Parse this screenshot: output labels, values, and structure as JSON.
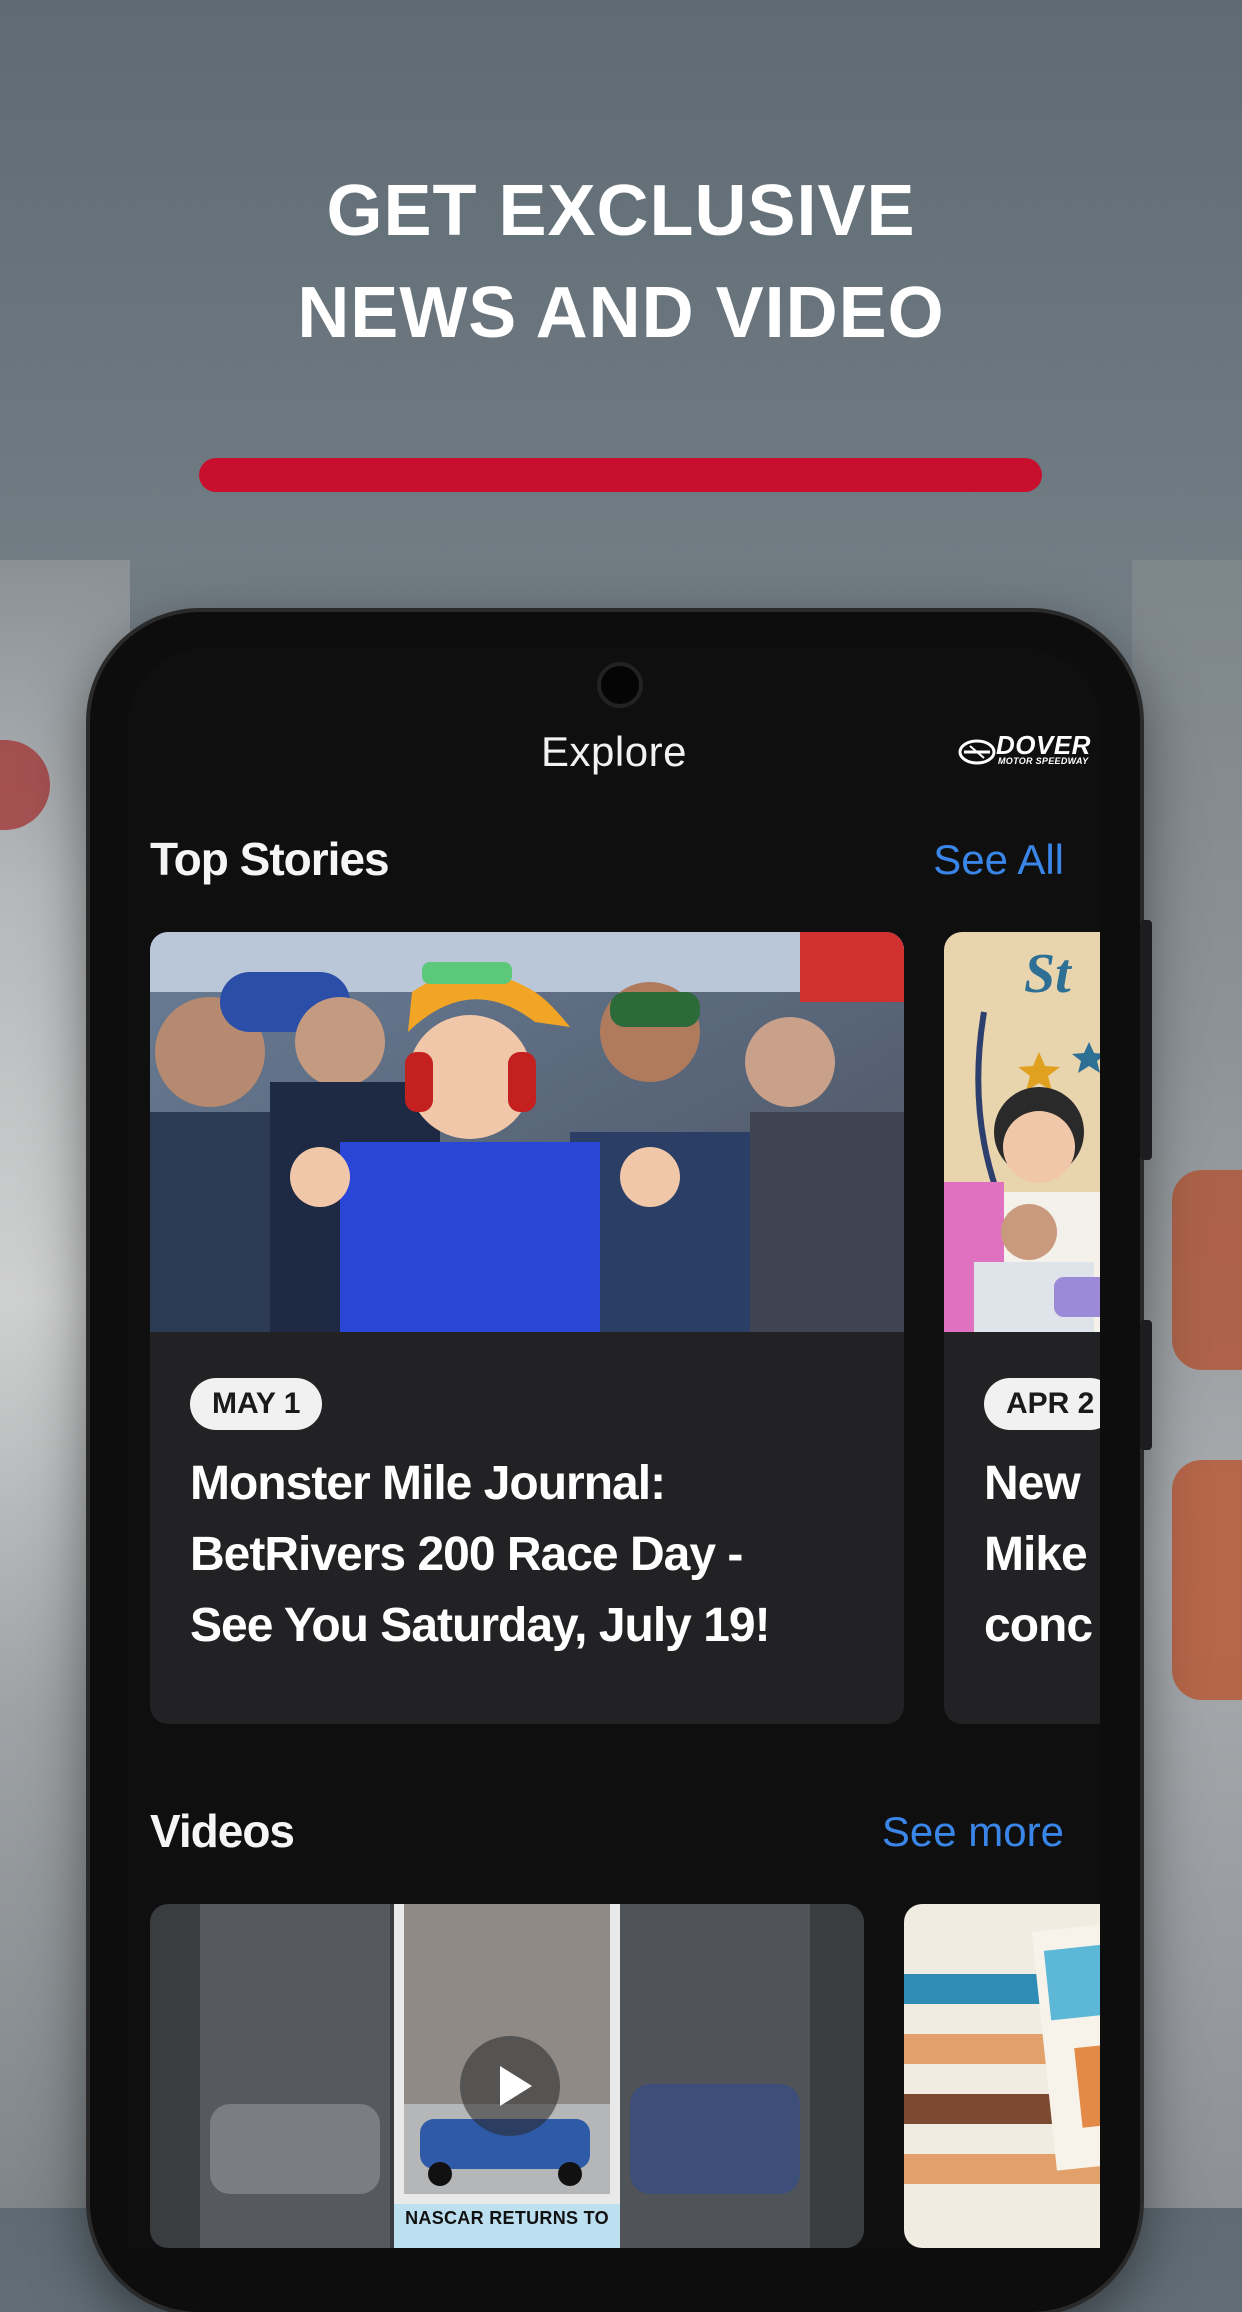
{
  "headline": {
    "line1": "GET EXCLUSIVE",
    "line2": "NEWS AND VIDEO"
  },
  "colors": {
    "accent_red": "#c8102e",
    "link_blue": "#3a86e8",
    "card_bg": "#222224",
    "screen_bg": "#0f0f10"
  },
  "app": {
    "title": "Explore",
    "logo": {
      "name": "DOVER",
      "sub": "MOTOR SPEEDWAY"
    }
  },
  "top_stories": {
    "heading": "Top Stories",
    "link": "See All",
    "items": [
      {
        "date": "MAY 1",
        "title_lines": [
          "Monster Mile Journal:",
          "BetRivers 200 Race Day -",
          "See You Saturday, July 19!"
        ]
      },
      {
        "date": "APR 2",
        "title_lines": [
          "New",
          "Mike",
          "conc"
        ]
      }
    ]
  },
  "videos": {
    "heading": "Videos",
    "link": "See more",
    "items": [
      {
        "caption": "NASCAR RETURNS TO"
      },
      {
        "caption": ""
      }
    ]
  },
  "icons": [
    "play-icon",
    "dover-logo-icon",
    "camera-icon"
  ]
}
